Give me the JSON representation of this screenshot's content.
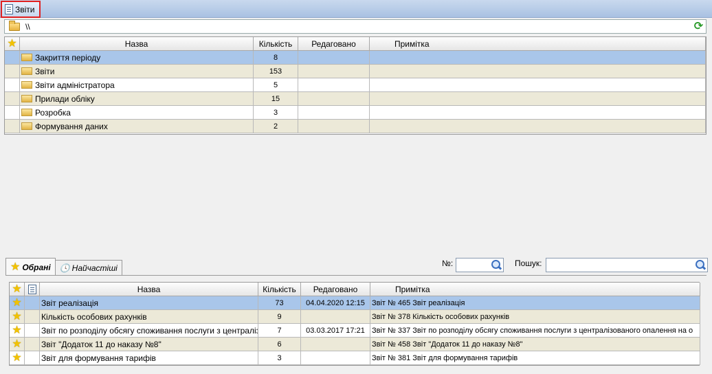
{
  "window": {
    "tab_label": "Звіти"
  },
  "path": {
    "value": "\\\\"
  },
  "folders_grid": {
    "columns": [
      "Назва",
      "Кількість",
      "Редаговано",
      "Примітка"
    ],
    "rows": [
      {
        "name": "Закриття періоду",
        "count": "8",
        "edited": "",
        "note": ""
      },
      {
        "name": "Звіти",
        "count": "153",
        "edited": "",
        "note": ""
      },
      {
        "name": "Звіти адміністратора",
        "count": "5",
        "edited": "",
        "note": ""
      },
      {
        "name": "Прилади обліку",
        "count": "15",
        "edited": "",
        "note": ""
      },
      {
        "name": "Розробка",
        "count": "3",
        "edited": "",
        "note": ""
      },
      {
        "name": "Формування даних",
        "count": "2",
        "edited": "",
        "note": ""
      }
    ]
  },
  "bottom_tabs": [
    {
      "label": "Обрані",
      "active": true
    },
    {
      "label": "Найчастіші",
      "active": false
    }
  ],
  "filters": {
    "number_label": "№:",
    "number_value": "",
    "search_label": "Пошук:",
    "search_value": ""
  },
  "reports_grid": {
    "columns": [
      "Назва",
      "Кількість",
      "Редаговано",
      "Примітка"
    ],
    "rows": [
      {
        "name": "Звіт реалізація",
        "count": "73",
        "edited": "04.04.2020 12:15",
        "note": "Звіт № 465 Звіт реалізація"
      },
      {
        "name": "Кількість особових рахунків",
        "count": "9",
        "edited": "",
        "note": "Звіт № 378 Кількість особових рахунків"
      },
      {
        "name": "Звіт по розподілу обсягу споживання послуги з централізованого опалення на о",
        "count": "7",
        "edited": "03.03.2017 17:21",
        "note": "Звіт № 337 Звіт по розподілу обсягу споживання послуги з централізованого опалення на о"
      },
      {
        "name": "Звіт \"Додаток 11 до наказу №8\"",
        "count": "6",
        "edited": "",
        "note": "Звіт № 458 Звіт \"Додаток 11 до наказу №8\""
      },
      {
        "name": "Звіт для формування тарифів",
        "count": "3",
        "edited": "",
        "note": "Звіт № 381 Звіт для формування тарифів"
      }
    ]
  }
}
